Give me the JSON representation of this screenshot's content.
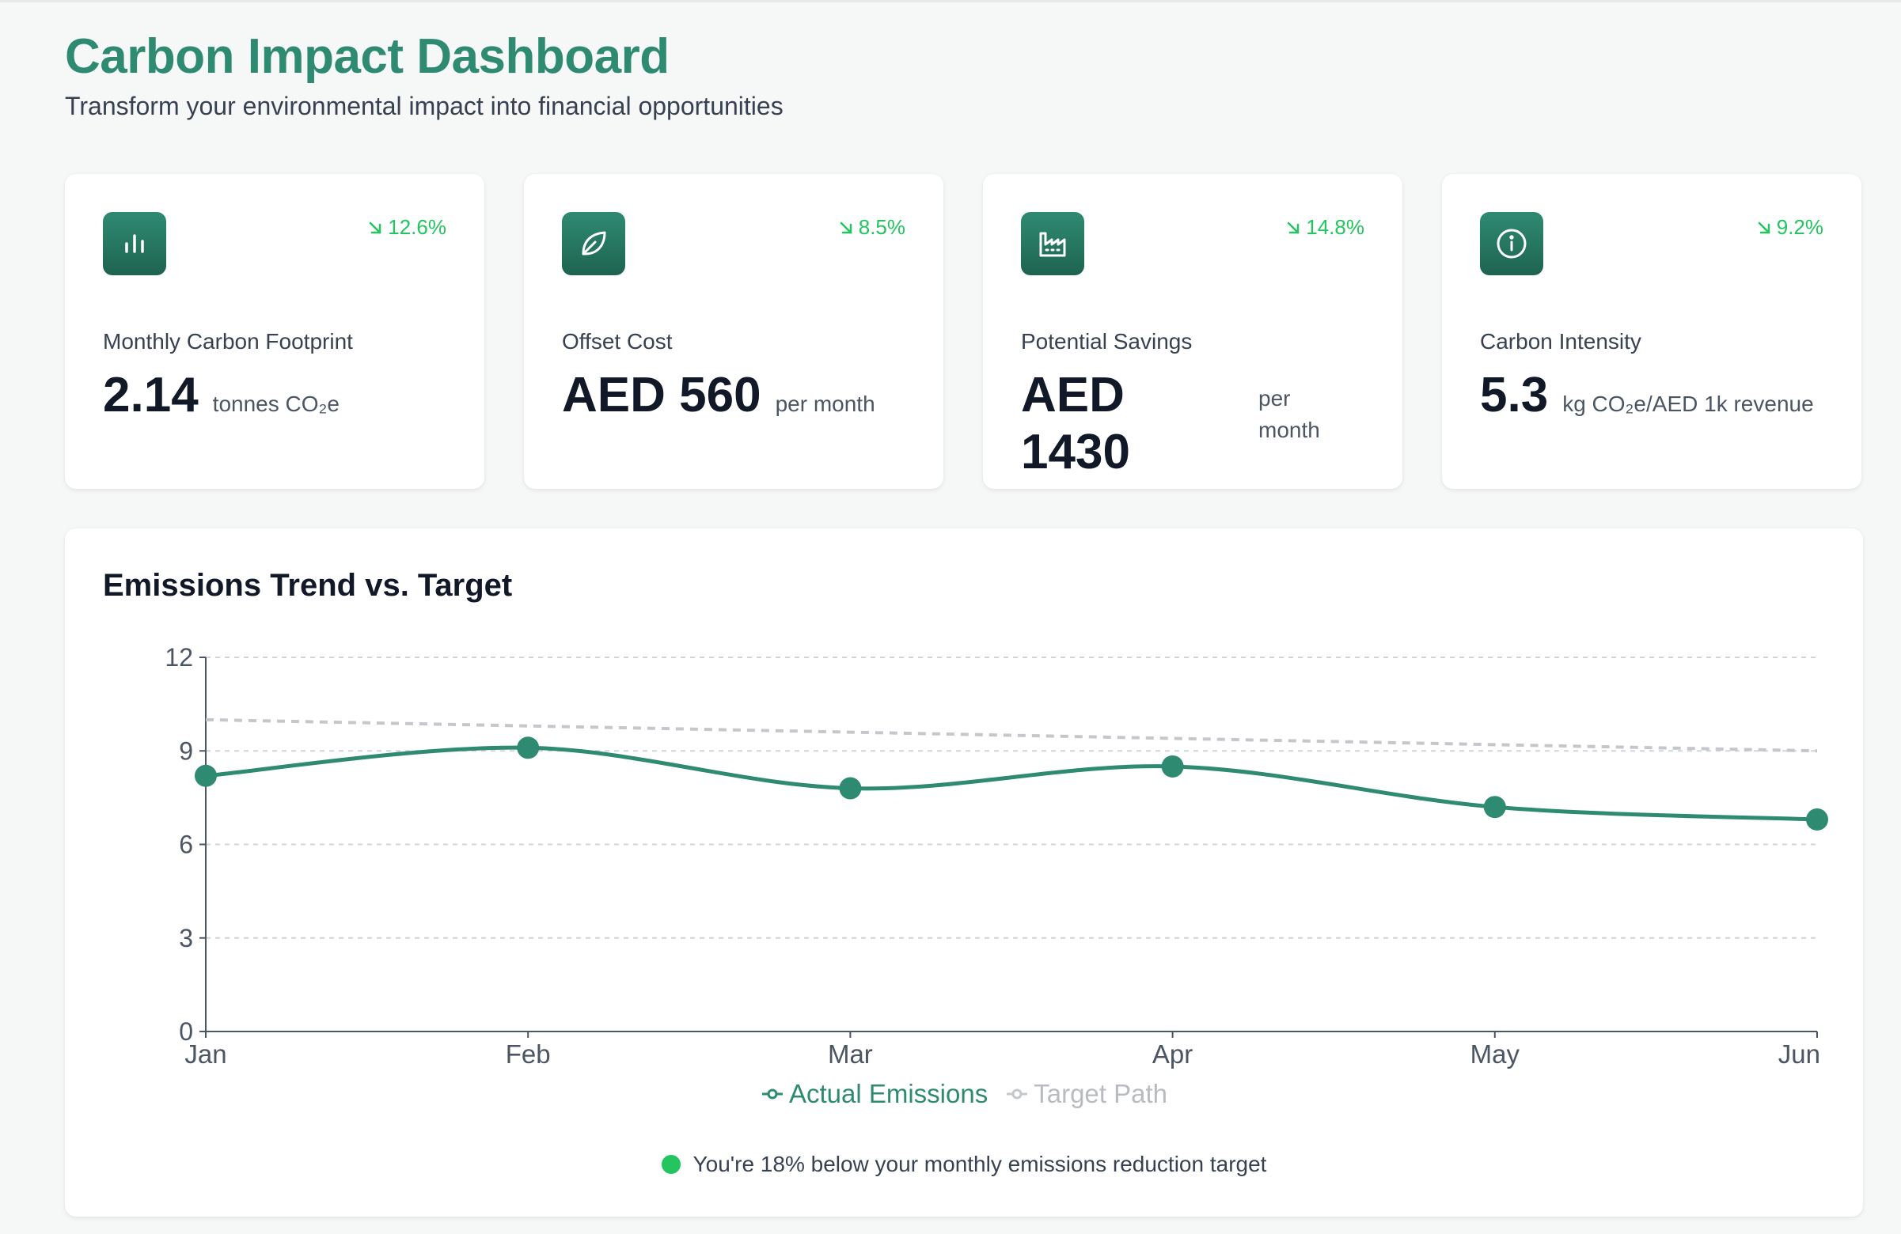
{
  "header": {
    "title": "Carbon Impact Dashboard",
    "subtitle": "Transform your environmental impact into financial opportunities"
  },
  "colors": {
    "brand": "#2f8a72",
    "positive": "#22c55e",
    "target": "#c4c8cc"
  },
  "cards": [
    {
      "icon": "bar-chart-icon",
      "change": "12.6%",
      "label": "Monthly Carbon Footprint",
      "value": "2.14",
      "unit": "tonnes CO₂e"
    },
    {
      "icon": "leaf-icon",
      "change": "8.5%",
      "label": "Offset Cost",
      "value": "AED 560",
      "unit": "per month"
    },
    {
      "icon": "factory-icon",
      "change": "14.8%",
      "label": "Potential Savings",
      "value_line1": "AED",
      "value_line2": "1430",
      "unit_line1": "per",
      "unit_line2": "month"
    },
    {
      "icon": "info-icon",
      "change": "9.2%",
      "label": "Carbon Intensity",
      "value": "5.3",
      "unit": "kg CO₂e/AED 1k revenue"
    }
  ],
  "chart_data": {
    "type": "line",
    "title": "Emissions Trend vs. Target",
    "categories": [
      "Jan",
      "Feb",
      "Mar",
      "Apr",
      "May",
      "Jun"
    ],
    "series": [
      {
        "name": "Actual Emissions",
        "values": [
          8.2,
          9.1,
          7.8,
          8.5,
          7.2,
          6.8
        ],
        "color": "#2f8a72"
      },
      {
        "name": "Target Path",
        "values": [
          10.0,
          9.8,
          9.6,
          9.4,
          9.2,
          9.0
        ],
        "color": "#c4c8cc"
      }
    ],
    "yticks": [
      0,
      3,
      6,
      9,
      12
    ],
    "ylim": [
      0,
      12
    ],
    "grid": true,
    "legend": "bottom-center"
  },
  "status": {
    "text": "You're 18% below your monthly emissions reduction target"
  }
}
